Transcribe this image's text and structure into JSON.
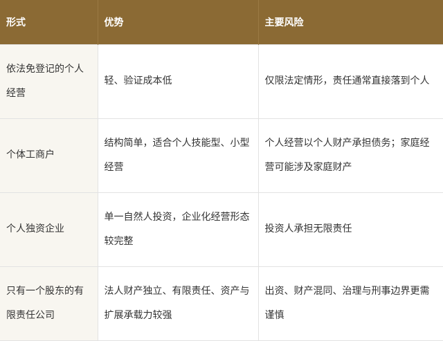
{
  "table": {
    "headers": [
      "形式",
      "优势",
      "主要风险"
    ],
    "rows": [
      [
        "依法免登记的个人经营",
        "轻、验证成本低",
        "仅限法定情形，责任通常直接落到个人"
      ],
      [
        "个体工商户",
        "结构简单，适合个人技能型、小型经营",
        "个人经营以个人财产承担债务；家庭经营可能涉及家庭财产"
      ],
      [
        "个人独资企业",
        "单一自然人投资，企业化经营形态较完整",
        "投资人承担无限责任"
      ],
      [
        "只有一个股东的有限责任公司",
        "法人财产独立、有限责任、资产与扩展承载力较强",
        "出资、财产混同、治理与刑事边界更需谨慎"
      ]
    ],
    "colors": {
      "header_bg": "#8b6a34",
      "header_text": "#ffffff",
      "first_col_bg": "#f8f6f0",
      "border": "#e2e2e2"
    }
  }
}
